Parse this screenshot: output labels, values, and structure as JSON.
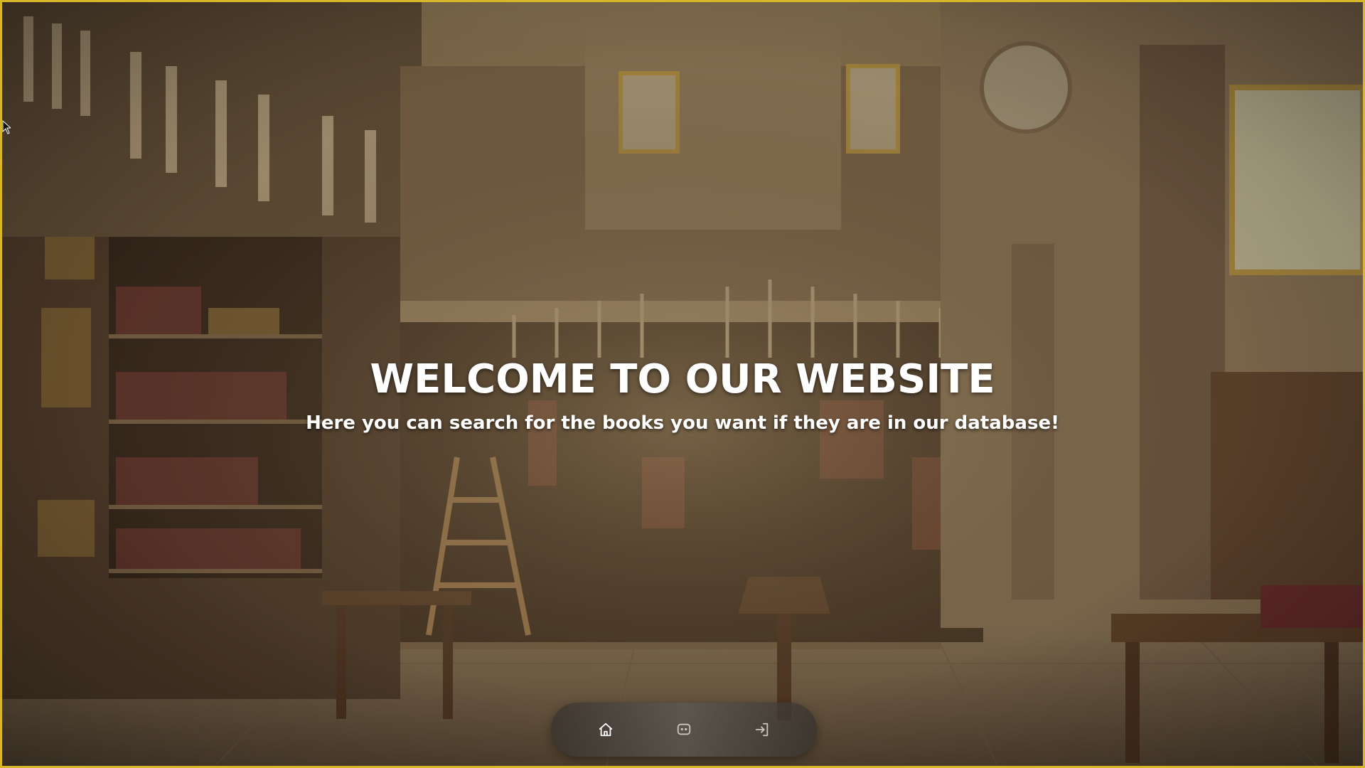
{
  "hero": {
    "title": "WELCOME TO OUR WEBSITE",
    "subtitle": "Here you can search for the books you want if they are in our database!"
  },
  "navbar": {
    "items": [
      {
        "icon": "home-icon",
        "active": true
      },
      {
        "icon": "chat-icon",
        "active": false
      },
      {
        "icon": "login-icon",
        "active": false
      }
    ]
  },
  "colors": {
    "frame_border": "#d8b62a",
    "active_icon": "#ffffff",
    "inactive_icon": "#c9c5bf"
  }
}
